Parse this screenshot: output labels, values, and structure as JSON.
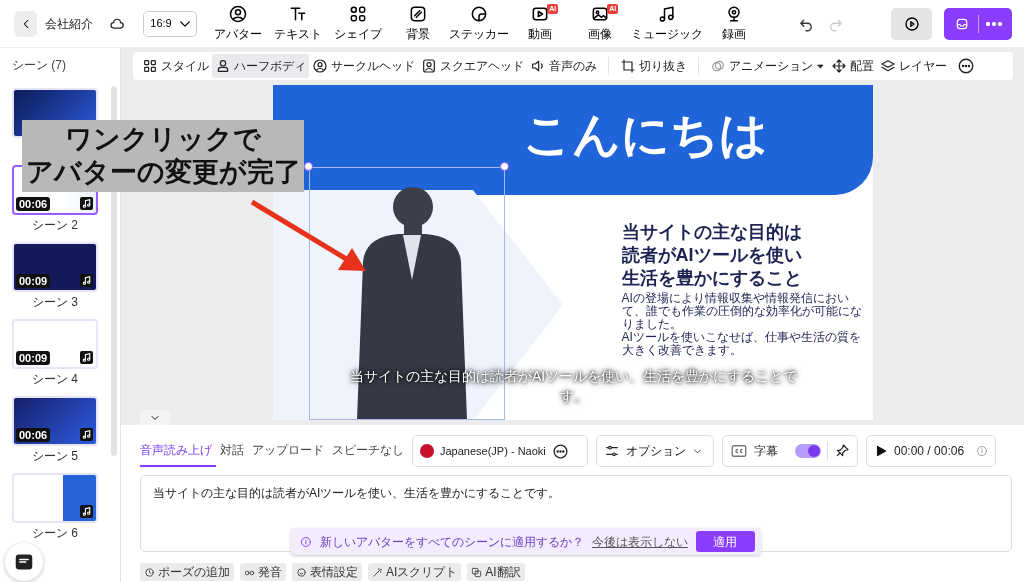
{
  "top_bar": {
    "title": "会社紹介",
    "aspect_ratio": "16:9",
    "tools": [
      {
        "label": "アバター"
      },
      {
        "label": "テキスト"
      },
      {
        "label": "シェイプ"
      },
      {
        "label": "背景"
      },
      {
        "label": "ステッカー"
      },
      {
        "label": "動画",
        "badge": "AI"
      },
      {
        "label": "画像",
        "badge": "AI"
      },
      {
        "label": "ミュージック"
      },
      {
        "label": "録画"
      }
    ],
    "undo": {
      "disabled": false
    },
    "redo": {
      "disabled": true
    }
  },
  "sidebar": {
    "title": "シーン (7)",
    "scenes": [
      {
        "selected": false
      },
      {
        "label": "シーン 2",
        "duration": "00:06",
        "selected": true
      },
      {
        "label": "シーン 3",
        "duration": "00:09",
        "selected": false
      },
      {
        "label": "シーン 4",
        "duration": "00:09",
        "selected": false
      },
      {
        "label": "シーン 5",
        "duration": "00:06",
        "selected": false
      },
      {
        "label": "シーン 6",
        "selected": false
      }
    ]
  },
  "avatar_toolbar": {
    "styles": [
      {
        "label": "スタイル",
        "selected": false
      },
      {
        "label": "ハーフボディ",
        "selected": true
      },
      {
        "label": "サークルヘッド",
        "selected": false
      },
      {
        "label": "スクエアヘッド",
        "selected": false
      },
      {
        "label": "音声のみ",
        "selected": false
      }
    ],
    "crop": "切り抜き",
    "animation": "アニメーション",
    "arrange": "配置",
    "layer": "レイヤー"
  },
  "slide": {
    "greeting": "こんにちは",
    "heading_lines": [
      "当サイトの主な目的は",
      "読者がAIツールを使い",
      "生活を豊かにすること"
    ],
    "body_paragraphs": [
      "AIの登場により情報収集や情報発信において、誰でも作業の圧倒的な効率化が可能になりました。",
      "AIツールを使いこなせば、仕事や生活の質を大きく改善できます。"
    ],
    "caption": "当サイトの主な目的は読者がAIツールを使い、生活を豊かにすることです。"
  },
  "annotation": {
    "lines": [
      "ワンクリックで",
      "アバターの変更が完了"
    ]
  },
  "speech_panel": {
    "tabs": [
      {
        "label": "音声読み上げ",
        "selected": true
      },
      {
        "label": "対話",
        "selected": false
      },
      {
        "label": "アップロード",
        "selected": false
      },
      {
        "label": "スピーチなし",
        "selected": false
      }
    ],
    "voice": "Japanese(JP) - Naoki",
    "options": "オプション",
    "subtitles": {
      "label": "字幕",
      "on": true
    },
    "playback": {
      "time": "00:00 / 00:06"
    },
    "script": "当サイトの主な目的は読者がAIツールを使い、生活を豊かにすることです。",
    "prompt": {
      "message": "新しいアバターをすべてのシーンに適用するか？",
      "dismiss_link": "今後は表示しない",
      "apply_button": "適用"
    },
    "actions": [
      "ポーズの追加",
      "発音",
      "表情設定",
      "AIスクリプト",
      "AI翻訳"
    ]
  }
}
